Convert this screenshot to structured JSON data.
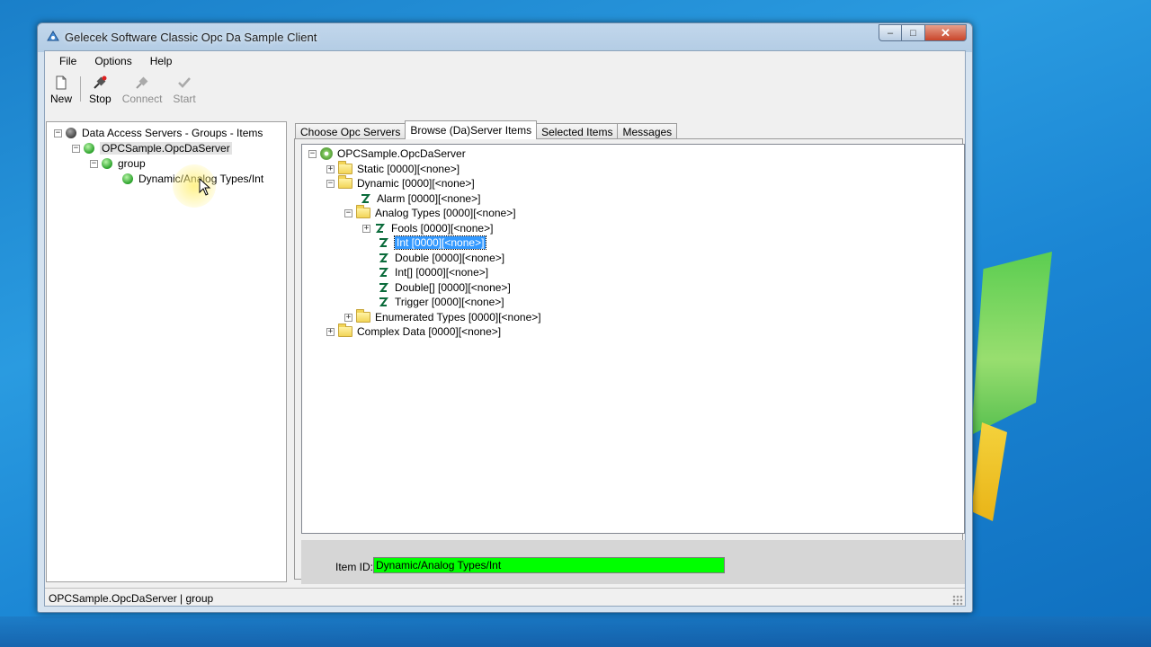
{
  "window": {
    "title": "Gelecek Software Classic Opc Da Sample Client",
    "controls": {
      "minimize": "–",
      "maximize": "□",
      "close": "✕"
    }
  },
  "menu": [
    "File",
    "Options",
    "Help"
  ],
  "toolbar": {
    "new": "New",
    "stop": "Stop",
    "connect": "Connect",
    "start": "Start"
  },
  "left_tree": {
    "root": "Data Access Servers - Groups - Items",
    "server": "OPCSample.OpcDaServer",
    "group": "group",
    "item": "Dynamic/Analog Types/Int"
  },
  "tabs": [
    "Choose Opc Servers",
    "Browse (Da)Server Items",
    "Selected Items",
    "Messages"
  ],
  "active_tab": "Browse (Da)Server Items",
  "browse_tree": {
    "root": "OPCSample.OpcDaServer",
    "static": "Static [0000][<none>]",
    "dynamic": "Dynamic [0000][<none>]",
    "alarm": "Alarm [0000][<none>]",
    "analog_types": "Analog Types [0000][<none>]",
    "fools": "Fools [0000][<none>]",
    "int": "Int [0000][<none>]",
    "double": "Double [0000][<none>]",
    "int_array": "Int[] [0000][<none>]",
    "double_array": "Double[] [0000][<none>]",
    "trigger": "Trigger [0000][<none>]",
    "enumerated_types": "Enumerated Types [0000][<none>]",
    "complex_data": "Complex Data [0000][<none>]"
  },
  "item_id": {
    "label": "Item ID:",
    "value": "Dynamic/Analog Types/Int"
  },
  "status": "OPCSample.OpcDaServer | group",
  "colors": {
    "item_id_field": "#00ff00",
    "selection": "#3399ff"
  }
}
